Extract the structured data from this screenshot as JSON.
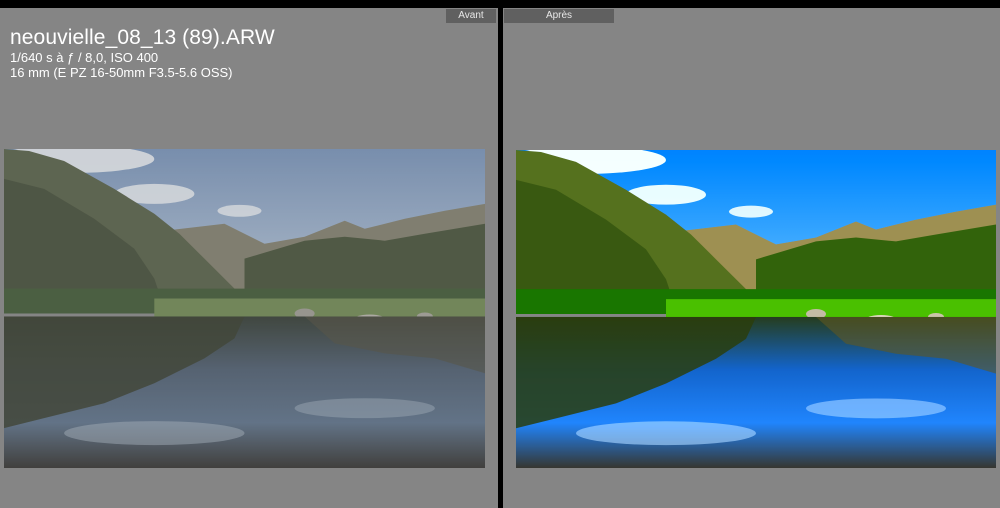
{
  "compare_view": {
    "before_label": "Avant",
    "after_label": "Après"
  },
  "photo_info": {
    "filename": "neouvielle_08_13 (89).ARW",
    "exposure": "1/640 s à ƒ / 8,0, ISO 400",
    "lens": "16 mm (E PZ 16-50mm F3.5-5.6 OSS)"
  },
  "colors": {
    "panel_bg": "#858585",
    "divider": "#000000",
    "tab_bg": "#606060",
    "text": "#ffffff"
  },
  "photo": {
    "subject": "mountain-lake-landscape"
  }
}
